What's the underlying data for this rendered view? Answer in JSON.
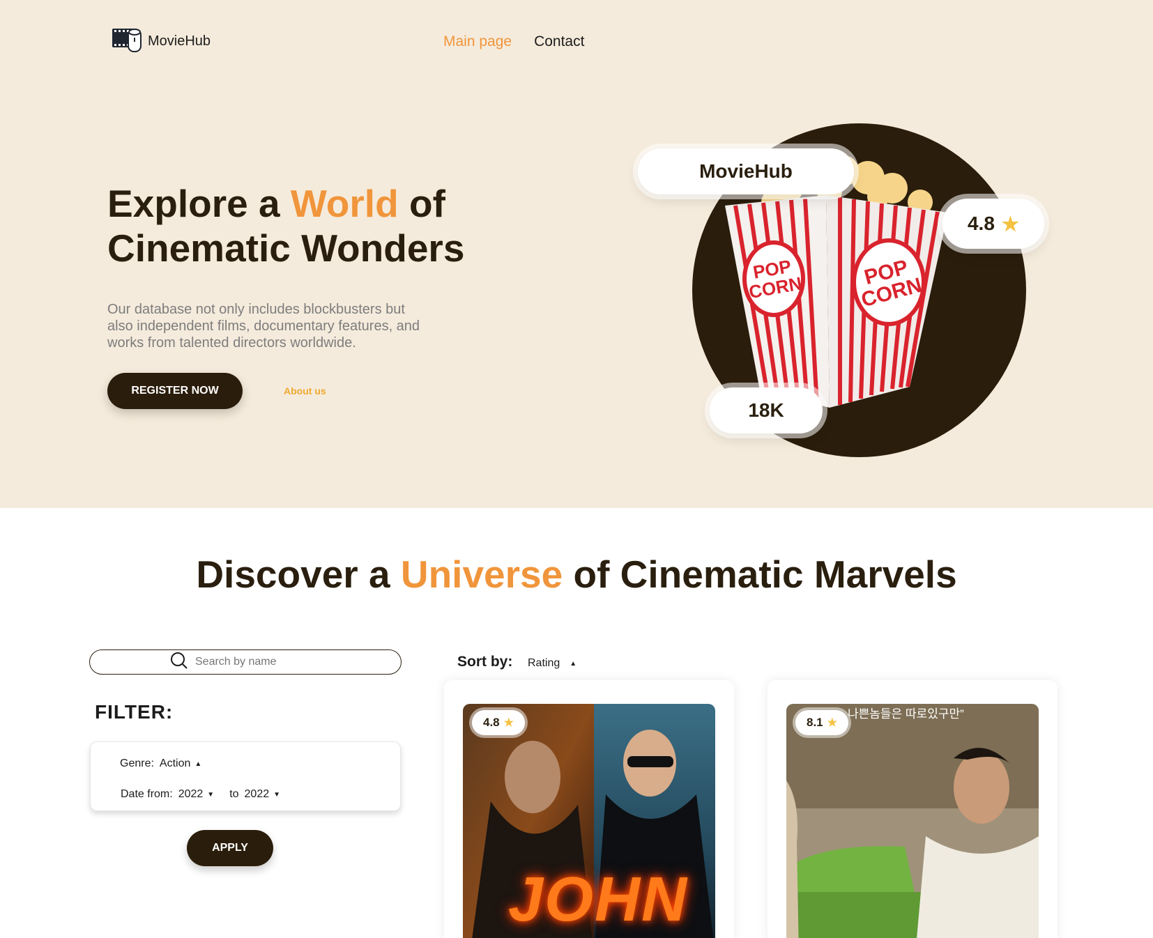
{
  "header": {
    "logo_text": "MovieHub",
    "nav": [
      {
        "label": "Main page",
        "active": true
      },
      {
        "label": "Contact",
        "active": false
      }
    ]
  },
  "hero": {
    "title_part1": "Explore a ",
    "title_accent": "World",
    "title_part2": " of",
    "title_line2": "Cinematic Wonders",
    "description": "Our database not only includes blockbusters but also independent films, documentary features, and works from talented directors worldwide.",
    "register_label": "REGISTER NOW",
    "about_label": "About us",
    "pill_brand": "MovieHub",
    "pill_rating": "4.8",
    "pill_count": "18K"
  },
  "discover": {
    "title_part1": "Discover a ",
    "title_accent": "Universe",
    "title_part2": " of Cinematic Marvels"
  },
  "search": {
    "placeholder": "Search by name"
  },
  "filter": {
    "label": "FILTER:",
    "genre_label": "Genre:",
    "genre_value": "Action",
    "date_from_label": "Date from:",
    "date_from_value": "2022",
    "date_to_label": "to",
    "date_to_value": "2022",
    "apply_label": "APPLY"
  },
  "sort": {
    "label": "Sort by:",
    "value": "Rating"
  },
  "movies": [
    {
      "rating": "4.8",
      "poster_text": "JOHN"
    },
    {
      "rating": "8.1",
      "poster_text": "나쁜놈들은 따로있구만”"
    }
  ],
  "colors": {
    "accent": "#f0953b",
    "dark": "#2b1d0b",
    "hero_bg": "#f5ebdc",
    "star": "#f5c242"
  }
}
